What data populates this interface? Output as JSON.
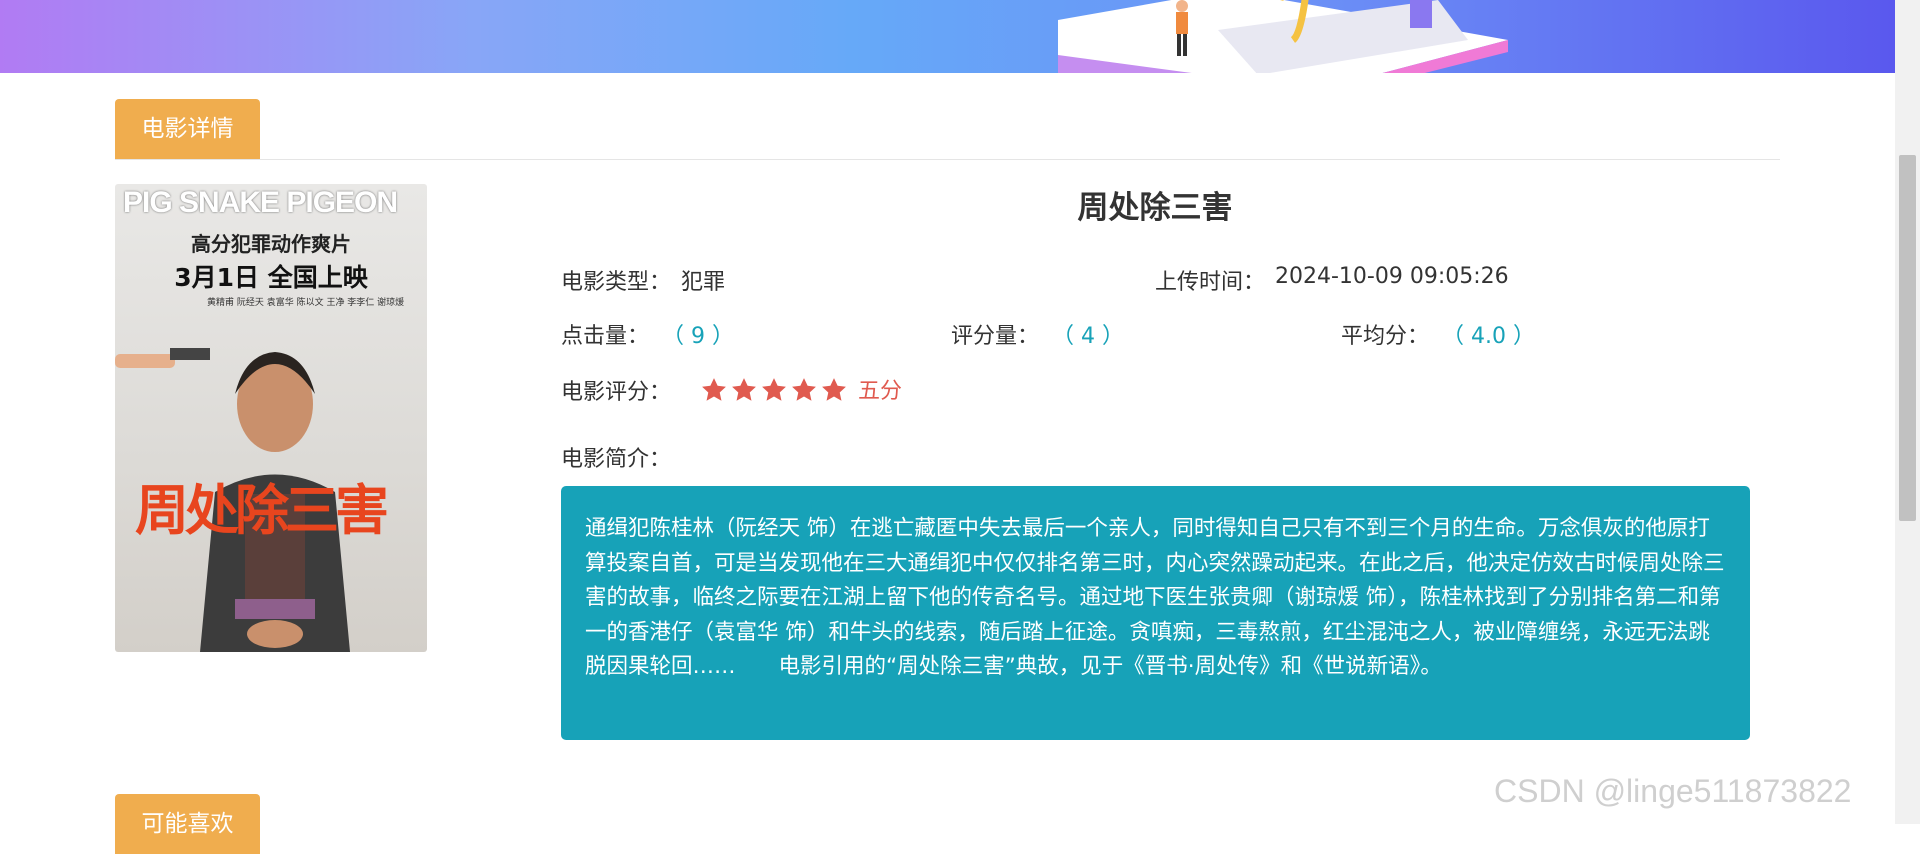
{
  "tabs": {
    "detail": "电影详情",
    "recommend": "可能喜欢"
  },
  "poster": {
    "title_text": "PIG SNAKE PIGEON",
    "tagline": "高分犯罪动作爽片",
    "release": "3月1日  全国上映",
    "credits": "黄精甫   阮经天   袁富华 陈以文 王净 李李仁 谢琼煖",
    "calligraphy": "周处除三害"
  },
  "movie": {
    "title": "周处除三害",
    "type_label": "电影类型：",
    "type_value": "犯罪",
    "upload_label": "上传时间：",
    "upload_value": "2024-10-09 09:05:26",
    "clicks_label": "点击量：",
    "clicks_value": "（ 9 ）",
    "ratings_label": "评分量：",
    "ratings_value": "（ 4 ）",
    "avg_label": "平均分：",
    "avg_value": "（ 4.0 ）",
    "rating_label": "电影评分：",
    "rating_stars": 5,
    "rating_text": "五分",
    "summary_label": "电影简介：",
    "summary": "通缉犯陈桂林（阮经天 饰）在逃亡藏匿中失去最后一个亲人，同时得知自己只有不到三个月的生命。万念俱灰的他原打算投案自首，可是当发现他在三大通缉犯中仅仅排名第三时，内心突然躁动起来。在此之后，他决定仿效古时候周处除三害的故事，临终之际要在江湖上留下他的传奇名号。通过地下医生张贵卿（谢琼煖 饰），陈桂林找到了分别排名第二和第一的香港仔（袁富华 饰）和牛头的线索，随后踏上征途。贪嗔痴，三毒熬煎，红尘混沌之人，被业障缠绕，永远无法跳脱因果轮回……　　电影引用的“周处除三害”典故，见于《晋书·周处传》和《世说新语》。"
  },
  "watermark": "CSDN @linge511873822",
  "colors": {
    "tab": "#f0ad4e",
    "summary_bg": "#17a2b8",
    "star": "#e05a4f",
    "accent": "#17a2b8"
  },
  "icons": {
    "star": "star-icon"
  }
}
